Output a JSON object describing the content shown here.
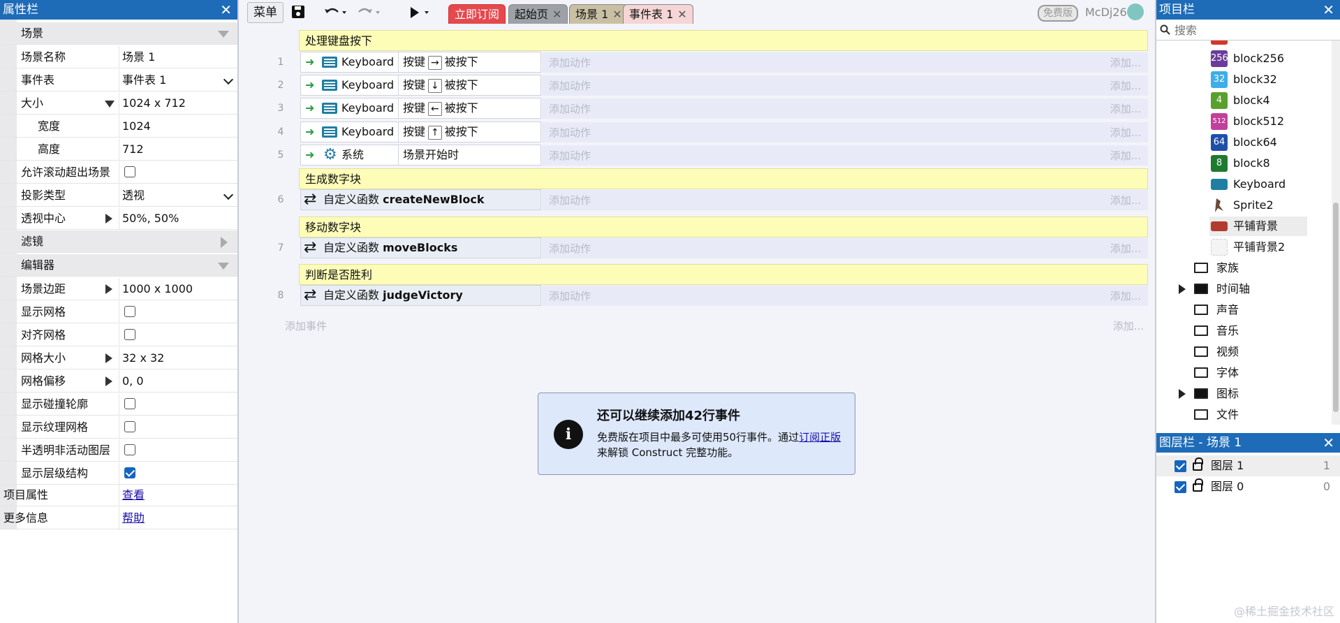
{
  "props": {
    "title": "属性栏",
    "close": "✕",
    "cat_scene": "场景",
    "rows": {
      "scene_name": {
        "label": "场景名称",
        "value": "场景 1"
      },
      "event_sheet": {
        "label": "事件表",
        "value": "事件表 1"
      },
      "size": {
        "label": "大小",
        "value": "1024 x 712"
      },
      "width": {
        "label": "宽度",
        "value": "1024"
      },
      "height": {
        "label": "高度",
        "value": "712"
      },
      "allow_scroll": {
        "label": "允许滚动超出场景"
      },
      "projection": {
        "label": "投影类型",
        "value": "透视"
      },
      "vanish": {
        "label": "透视中心",
        "value": "50%, 50%"
      },
      "cat_filter": {
        "label": "滤镜"
      },
      "cat_editor": {
        "label": "编辑器"
      },
      "margin": {
        "label": "场景边距",
        "value": "1000 x 1000"
      },
      "show_grid": {
        "label": "显示网格"
      },
      "snap_grid": {
        "label": "对齐网格"
      },
      "grid_size": {
        "label": "网格大小",
        "value": "32 x 32"
      },
      "grid_offset": {
        "label": "网格偏移",
        "value": "0, 0"
      },
      "show_collision": {
        "label": "显示碰撞轮廓"
      },
      "show_texture": {
        "label": "显示纹理网格"
      },
      "translucent": {
        "label": "半透明非活动图层"
      },
      "show_hierarchy": {
        "label": "显示层级结构"
      },
      "project_props": {
        "label": "项目属性",
        "value": "查看"
      },
      "more_info": {
        "label": "更多信息",
        "value": "帮助"
      }
    }
  },
  "toolbar": {
    "menu": "菜单",
    "tabs": [
      "立即订阅",
      "起始页",
      "场景 1",
      "事件表 1"
    ],
    "tab_close": "✕",
    "free_badge": "免费版",
    "user": "McDj26"
  },
  "events": {
    "groups": [
      "处理键盘按下",
      "生成数字块",
      "移动数字块",
      "判断是否胜利"
    ],
    "key_prefix": "按键",
    "key_suffix": "被按下",
    "keyboard": "Keyboard",
    "keys": [
      "→",
      "↓",
      "←",
      "↑"
    ],
    "system": "系统",
    "on_start": "场景开始时",
    "func_prefix": "自定义函数",
    "funcs": [
      "createNewBlock",
      "moveBlocks",
      "judgeVictory"
    ],
    "add_action": "添加动作",
    "add_more": "添加...",
    "add_event": "添加事件",
    "line_numbers": [
      "1",
      "2",
      "3",
      "4",
      "5",
      "6",
      "7",
      "8"
    ]
  },
  "notice": {
    "title": "还可以继续添加42行事件",
    "body_1": "免费版在项目中最多可使用50行事件。通过",
    "link_1": "订阅",
    "link_2": "正版",
    "body_2": "来解锁 Construct 完整功能。",
    "icon": "i"
  },
  "project": {
    "title": "项目栏",
    "close": "✕",
    "search_placeholder": "搜索",
    "items": [
      {
        "badge": "256",
        "name": "block256",
        "color": "#6a3d9a"
      },
      {
        "badge": "32",
        "name": "block32",
        "color": "#3daee9"
      },
      {
        "badge": "4",
        "name": "block4",
        "color": "#5aa02c"
      },
      {
        "badge": "512",
        "name": "block512",
        "color": "#c2409b"
      },
      {
        "badge": "64",
        "name": "block64",
        "color": "#1f4fa8"
      },
      {
        "badge": "8",
        "name": "block8",
        "color": "#1e7a2e"
      }
    ],
    "keyboard": "Keyboard",
    "sprite2": "Sprite2",
    "tiled1": "平铺背景",
    "tiled2": "平铺背景2",
    "folders": [
      "家族",
      "时间轴",
      "声音",
      "音乐",
      "视频",
      "字体",
      "图标",
      "文件"
    ]
  },
  "layers": {
    "title": "图层栏 - 场景 1",
    "close": "✕",
    "items": [
      {
        "name": "图层 1",
        "index": "1"
      },
      {
        "name": "图层 0",
        "index": "0"
      }
    ]
  },
  "watermark": "@稀土掘金技术社区"
}
